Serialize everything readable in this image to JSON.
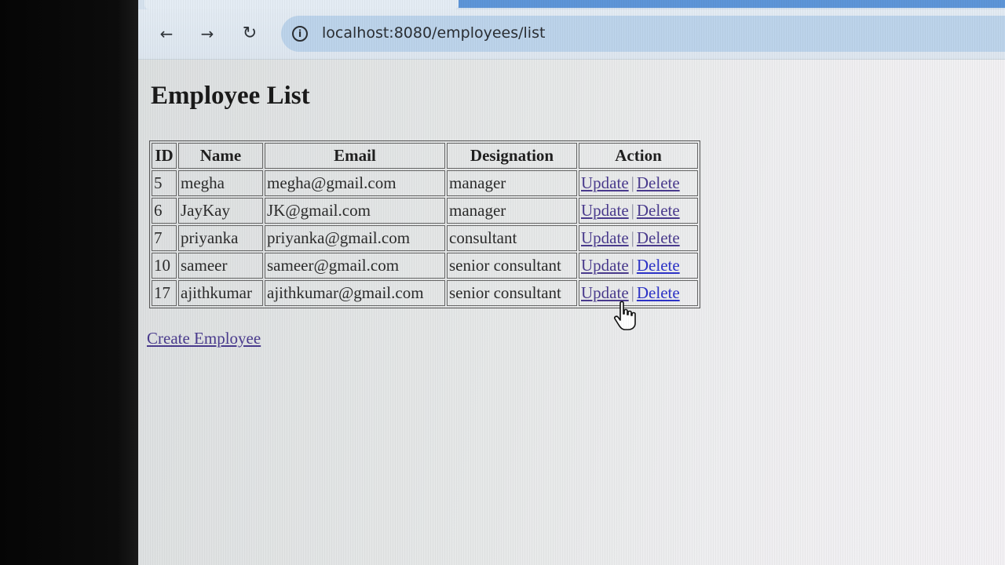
{
  "browser": {
    "url": "localhost:8080/employees/list",
    "back_icon": "←",
    "forward_icon": "→",
    "reload_icon": "↻",
    "info_icon": "i"
  },
  "page": {
    "title": "Employee List",
    "create_link": "Create Employee"
  },
  "table": {
    "headers": [
      "ID",
      "Name",
      "Email",
      "Designation",
      "Action"
    ],
    "rows": [
      {
        "id": "5",
        "name": "megha",
        "email": "megha@gmail.com",
        "designation": "manager",
        "update": "Update",
        "separator": "|",
        "delete": "Delete"
      },
      {
        "id": "6",
        "name": "JayKay",
        "email": "JK@gmail.com",
        "designation": "manager",
        "update": "Update",
        "separator": "|",
        "delete": "Delete"
      },
      {
        "id": "7",
        "name": "priyanka",
        "email": "priyanka@gmail.com",
        "designation": "consultant",
        "update": "Update",
        "separator": "|",
        "delete": "Delete"
      },
      {
        "id": "10",
        "name": "sameer",
        "email": "sameer@gmail.com",
        "designation": "senior consultant",
        "update": "Update",
        "separator": "|",
        "delete": "Delete"
      },
      {
        "id": "17",
        "name": "ajithkumar",
        "email": "ajithkumar@gmail.com",
        "designation": "senior consultant",
        "update": "Update",
        "separator": "|",
        "delete": "Delete"
      }
    ]
  },
  "colors": {
    "link_visited": "#4a3b8e",
    "link_unvisited": "#2d33c8",
    "address_bar": "#bcd3ea"
  }
}
